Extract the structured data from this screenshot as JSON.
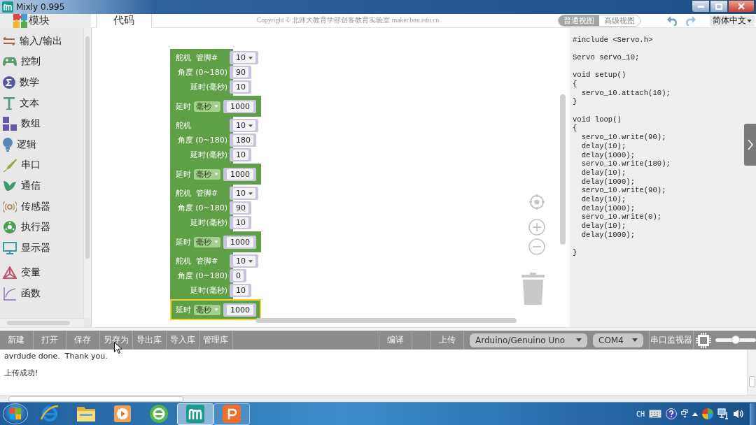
{
  "window": {
    "title": "Mixly 0.995"
  },
  "tabs": [
    {
      "label": "模块",
      "selected": true
    },
    {
      "label": "代码",
      "selected": false
    }
  ],
  "copyright": "Copyright © 北师大教育学部创客教育实验室 maker.bnu.edu.cn",
  "view_modes": [
    {
      "label": "普通视图",
      "selected": true
    },
    {
      "label": "高级视图",
      "selected": false
    }
  ],
  "language": "简体中文",
  "sidebar": {
    "groups": [
      [
        {
          "kind": "io",
          "label": "输入/输出"
        },
        {
          "kind": "control",
          "label": "控制"
        },
        {
          "kind": "math",
          "label": "数学"
        },
        {
          "kind": "text",
          "label": "文本"
        },
        {
          "kind": "array",
          "label": "数组"
        },
        {
          "kind": "logic",
          "label": "逻辑"
        },
        {
          "kind": "serial",
          "label": "串口"
        },
        {
          "kind": "comm",
          "label": "通信"
        },
        {
          "kind": "sensor",
          "label": "传感器"
        },
        {
          "kind": "actuator",
          "label": "执行器"
        },
        {
          "kind": "display",
          "label": "显示器"
        }
      ],
      [
        {
          "kind": "variable",
          "label": "变量"
        },
        {
          "kind": "function",
          "label": "函数"
        }
      ]
    ]
  },
  "blocks": [
    {
      "kind": "servo",
      "label": "舵机",
      "pin_label": "管脚#",
      "pin": "10",
      "angle_label": "角度 (0~180)",
      "angle": "90",
      "delay_label": "延时(毫秒)",
      "delay": "10",
      "selected": false
    },
    {
      "kind": "delay",
      "label": "延时",
      "unit": "毫秒",
      "value": "1000",
      "selected": false
    },
    {
      "kind": "servo",
      "label": "舵机",
      "pin": "10",
      "angle_label": "角度 (0~180)",
      "angle": "180",
      "delay_label": "延时(毫秒)",
      "delay": "10",
      "selected": false
    },
    {
      "kind": "delay",
      "label": "延时",
      "unit": "毫秒",
      "value": "1000",
      "selected": false
    },
    {
      "kind": "servo",
      "label": "舵机",
      "pin_label": "管脚#",
      "pin": "10",
      "angle_label": "角度 (0~180)",
      "angle": "90",
      "delay_label": "延时(毫秒)",
      "delay": "10",
      "selected": false
    },
    {
      "kind": "delay",
      "label": "延时",
      "unit": "毫秒",
      "value": "1000",
      "selected": false
    },
    {
      "kind": "servo",
      "label": "舵机",
      "pin_label": "管脚#",
      "pin": "10",
      "angle_label": "角度 (0~180)",
      "angle": "0",
      "delay_label": "延时(毫秒)",
      "delay": "10",
      "selected": false
    },
    {
      "kind": "delay",
      "label": "延时",
      "unit": "毫秒",
      "value": "1000",
      "selected": true
    }
  ],
  "code": {
    "groups": [
      [
        "#include <Servo.h>"
      ],
      [
        "Servo servo_10;"
      ],
      [
        "void setup()",
        "{",
        "  servo_10.attach(10);",
        "}"
      ],
      [
        "void loop()",
        "{",
        "  servo_10.write(90);",
        "  delay(10);",
        "  delay(1000);",
        "  servo_10.write(180);",
        "  delay(10);",
        "  delay(1000);",
        "  servo_10.write(90);",
        "  delay(10);",
        "  delay(1000);",
        "  servo_10.write(0);",
        "  delay(10);",
        "  delay(1000);"
      ],
      [
        "}"
      ]
    ]
  },
  "toolbar": {
    "file_buttons": [
      "新建",
      "打开",
      "保存",
      "另存为",
      "导出库",
      "导入库",
      "管理库"
    ],
    "compile": "编译",
    "upload": "上传",
    "board": "Arduino/Genuino Uno",
    "port": "COM4",
    "serial_monitor": "串口监视器",
    "slider": {
      "level": 0.5
    }
  },
  "console": {
    "lines": [
      "avrdude done.  Thank you.",
      "上传成功!"
    ]
  },
  "taskbar": {
    "apps": [
      {
        "kind": "browser",
        "running": false,
        "selected": false
      },
      {
        "kind": "files",
        "running": false,
        "selected": false
      },
      {
        "kind": "media",
        "running": false,
        "selected": false
      },
      {
        "kind": "web",
        "running": false,
        "selected": false
      },
      {
        "kind": "mixly",
        "running": true,
        "selected": true
      },
      {
        "kind": "slides",
        "running": true,
        "selected": false
      }
    ],
    "input_language": "CH"
  }
}
